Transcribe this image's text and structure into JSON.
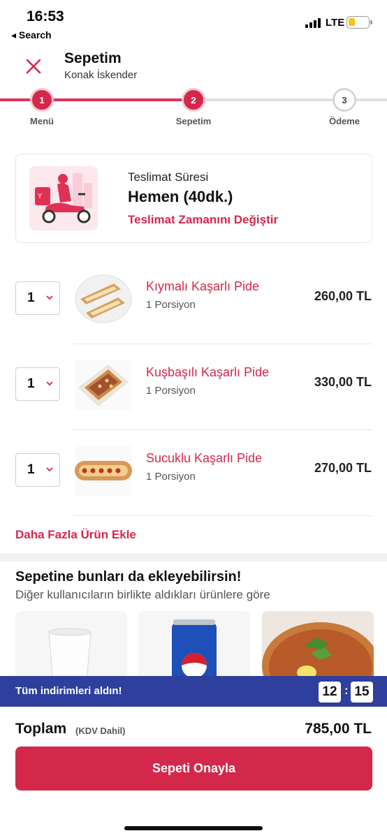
{
  "status_bar": {
    "time": "16:53",
    "back_label": "◂ Search",
    "network": "LTE"
  },
  "header": {
    "title": "Sepetim",
    "subtitle": "Konak İskender",
    "close_icon": "close-icon"
  },
  "steps": [
    {
      "number": "1",
      "label": "Menü",
      "state": "done"
    },
    {
      "number": "2",
      "label": "Sepetim",
      "state": "active"
    },
    {
      "number": "3",
      "label": "Ödeme",
      "state": "upcoming"
    }
  ],
  "delivery": {
    "label": "Teslimat Süresi",
    "value": "Hemen (40dk.)",
    "change_link": "Teslimat Zamanını Değiştir"
  },
  "cart_items": [
    {
      "qty": "1",
      "name": "Kıymalı Kaşarlı Pide",
      "portion": "1 Porsiyon",
      "price": "260,00 TL"
    },
    {
      "qty": "1",
      "name": "Kuşbaşılı Kaşarlı Pide",
      "portion": "1 Porsiyon",
      "price": "330,00 TL"
    },
    {
      "qty": "1",
      "name": "Sucuklu Kaşarlı Pide",
      "portion": "1 Porsiyon",
      "price": "270,00 TL"
    }
  ],
  "add_more": "Daha Fazla Ürün Ekle",
  "recommendations": {
    "title": "Sepetine bunları da ekleyebilirsin!",
    "subtitle": "Diğer kullanıcıların birlikte aldıkları ürünlere göre"
  },
  "promo": {
    "text": "Tüm indirimleri aldın!",
    "timer_min": "12",
    "timer_sec": "15",
    "separator": ":"
  },
  "total": {
    "label": "Toplam",
    "vat_note": "(KDV Dahil)",
    "amount": "785,00 TL"
  },
  "confirm_button": "Sepeti Onayla",
  "colors": {
    "brand": "#d4284b",
    "promo_bar": "#2e3f9e"
  }
}
